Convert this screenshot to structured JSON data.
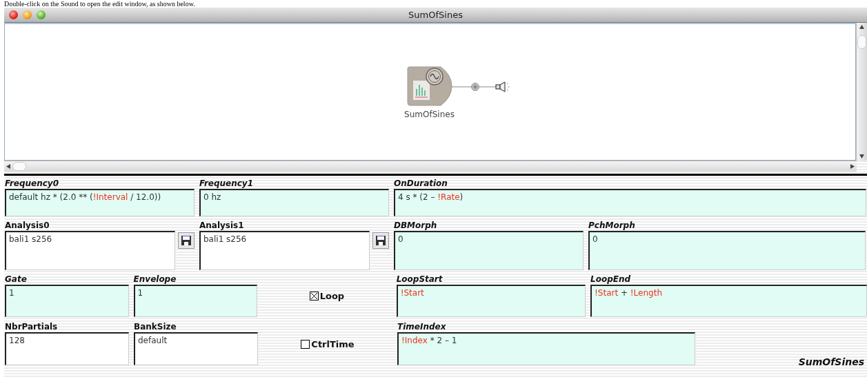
{
  "caption": "Double-click on the Sound to open the edit window, as shown below.",
  "window": {
    "title": "SumOfSines"
  },
  "canvas": {
    "node": {
      "label": "SumOfSines"
    }
  },
  "parameter_rows": [
    {
      "cells": [
        {
          "kind": "expression",
          "label": "Frequency0",
          "value": [
            {
              "kind": "text",
              "text": "default hz * (2.0 ** ("
            },
            {
              "kind": "variable",
              "text": "!Interval"
            },
            {
              "kind": "text",
              "text": " / 12.0))"
            }
          ]
        },
        {
          "kind": "expression",
          "label": "Frequency1",
          "value": [
            {
              "kind": "text",
              "text": "0 hz"
            }
          ]
        },
        {
          "kind": "expression",
          "label": "OnDuration",
          "value": [
            {
              "kind": "text",
              "text": "4 s * (2 – "
            },
            {
              "kind": "variable",
              "text": "!Rate"
            },
            {
              "kind": "text",
              "text": ")"
            }
          ]
        }
      ]
    },
    {
      "cells": [
        {
          "kind": "file",
          "label": "Analysis0",
          "value": [
            {
              "kind": "text",
              "text": "bali1 s256"
            }
          ]
        },
        {
          "kind": "file",
          "label": "Analysis1",
          "value": [
            {
              "kind": "text",
              "text": "bali1 s256"
            }
          ]
        },
        {
          "kind": "expression",
          "label": "DBMorph",
          "value": [
            {
              "kind": "text",
              "text": "0"
            }
          ]
        },
        {
          "kind": "expression",
          "label": "PchMorph",
          "value": [
            {
              "kind": "text",
              "text": "0"
            }
          ]
        }
      ]
    },
    {
      "cells": [
        {
          "kind": "expression",
          "label": "Gate",
          "value": [
            {
              "kind": "text",
              "text": "1"
            }
          ]
        },
        {
          "kind": "expression",
          "label": "Envelope",
          "value": [
            {
              "kind": "text",
              "text": "1"
            }
          ]
        },
        {
          "kind": "checkbox",
          "label": "Loop",
          "checked": true
        },
        {
          "kind": "expression",
          "label": "LoopStart",
          "value": [
            {
              "kind": "variable",
              "text": "!Start"
            }
          ]
        },
        {
          "kind": "expression",
          "label": "LoopEnd",
          "value": [
            {
              "kind": "variable",
              "text": "!Start"
            },
            {
              "kind": "text",
              "text": " + "
            },
            {
              "kind": "variable",
              "text": "!Length"
            }
          ]
        }
      ]
    },
    {
      "cells": [
        {
          "kind": "value",
          "label": "NbrPartials",
          "value": [
            {
              "kind": "text",
              "text": "128"
            }
          ]
        },
        {
          "kind": "value",
          "label": "BankSize",
          "value": [
            {
              "kind": "text",
              "text": "default"
            }
          ]
        },
        {
          "kind": "checkbox",
          "label": "CtrlTime",
          "checked": false
        },
        {
          "kind": "expression",
          "label": "TimeIndex",
          "value": [
            {
              "kind": "variable",
              "text": "!Index"
            },
            {
              "kind": "text",
              "text": " * 2 – 1"
            }
          ]
        }
      ]
    }
  ],
  "sound_name": "SumOfSines"
}
